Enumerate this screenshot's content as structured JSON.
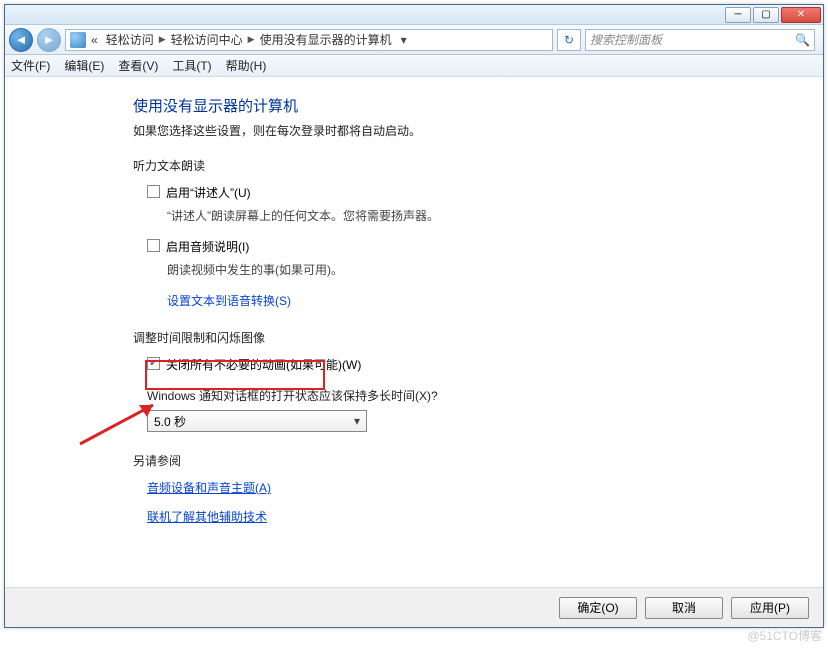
{
  "titlebar": {},
  "nav": {
    "chevrons": "«",
    "crumb1": "轻松访问",
    "crumb2": "轻松访问中心",
    "crumb3": "使用没有显示器的计算机",
    "search_placeholder": "搜索控制面板"
  },
  "menu": {
    "file": "文件(F)",
    "edit": "编辑(E)",
    "view": "查看(V)",
    "tools": "工具(T)",
    "help": "帮助(H)"
  },
  "page": {
    "title": "使用没有显示器的计算机",
    "subtitle": "如果您选择这些设置，则在每次登录时都将自动启动。",
    "section1": {
      "label": "听力文本朗读",
      "opt1": "启用“讲述人”(U)",
      "opt1_desc": "“讲述人”朗读屏幕上的任何文本。您将需要扬声器。",
      "opt2": "启用音频说明(I)",
      "opt2_desc": "朗读视频中发生的事(如果可用)。",
      "link1": "设置文本到语音转换(S)"
    },
    "section2": {
      "label": "调整时间限制和闪烁图像",
      "opt1": "关闭所有不必要的动画(如果可能)(W)",
      "q": "Windows 通知对话框的打开状态应该保持多长时间(X)?",
      "sel": "5.0 秒"
    },
    "section3": {
      "label": "另请参阅",
      "link1": "音频设备和声音主题(A)",
      "link2": "联机了解其他辅助技术"
    }
  },
  "buttons": {
    "ok": "确定(O)",
    "cancel": "取消",
    "apply": "应用(P)"
  },
  "watermark": "@51CTO博客"
}
